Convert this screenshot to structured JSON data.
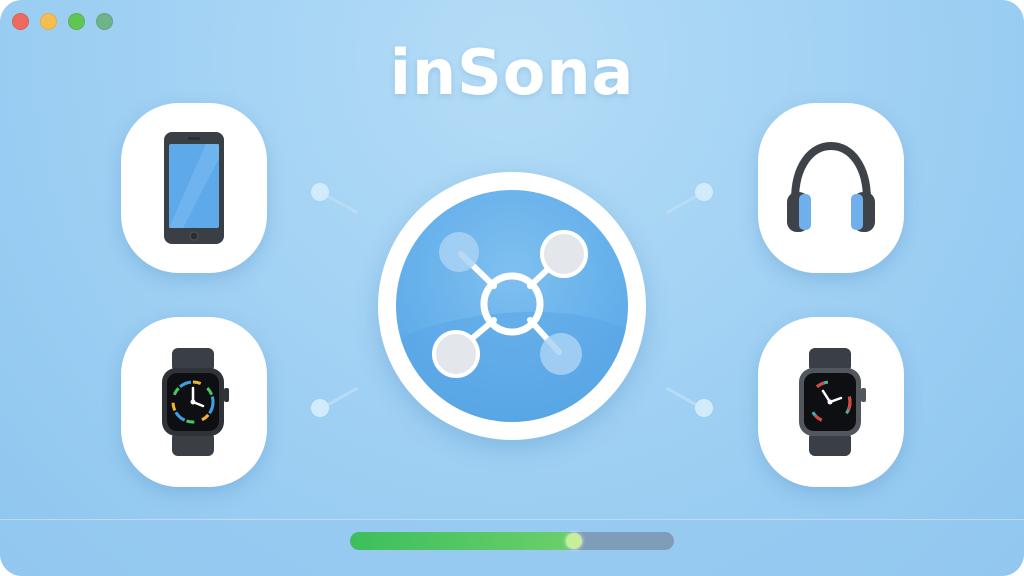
{
  "app": {
    "title": "inSona"
  },
  "window_controls": [
    {
      "name": "close-button",
      "color": "#ee6a5f"
    },
    {
      "name": "minimize-button",
      "color": "#f5bf4f"
    },
    {
      "name": "zoom-button",
      "color": "#61c554"
    },
    {
      "name": "extra-button",
      "color": "#6db48a"
    }
  ],
  "devices": [
    {
      "id": "phone",
      "icon": "smartphone-icon"
    },
    {
      "id": "headphones",
      "icon": "headphones-icon"
    },
    {
      "id": "watch-left",
      "icon": "smartwatch-icon"
    },
    {
      "id": "watch-right",
      "icon": "smartwatch-icon"
    }
  ],
  "hub": {
    "icon": "network-hub-icon"
  },
  "progress": {
    "value": 0.69,
    "fill_color": "#4cc45f",
    "track_color": "#7f9db8"
  }
}
